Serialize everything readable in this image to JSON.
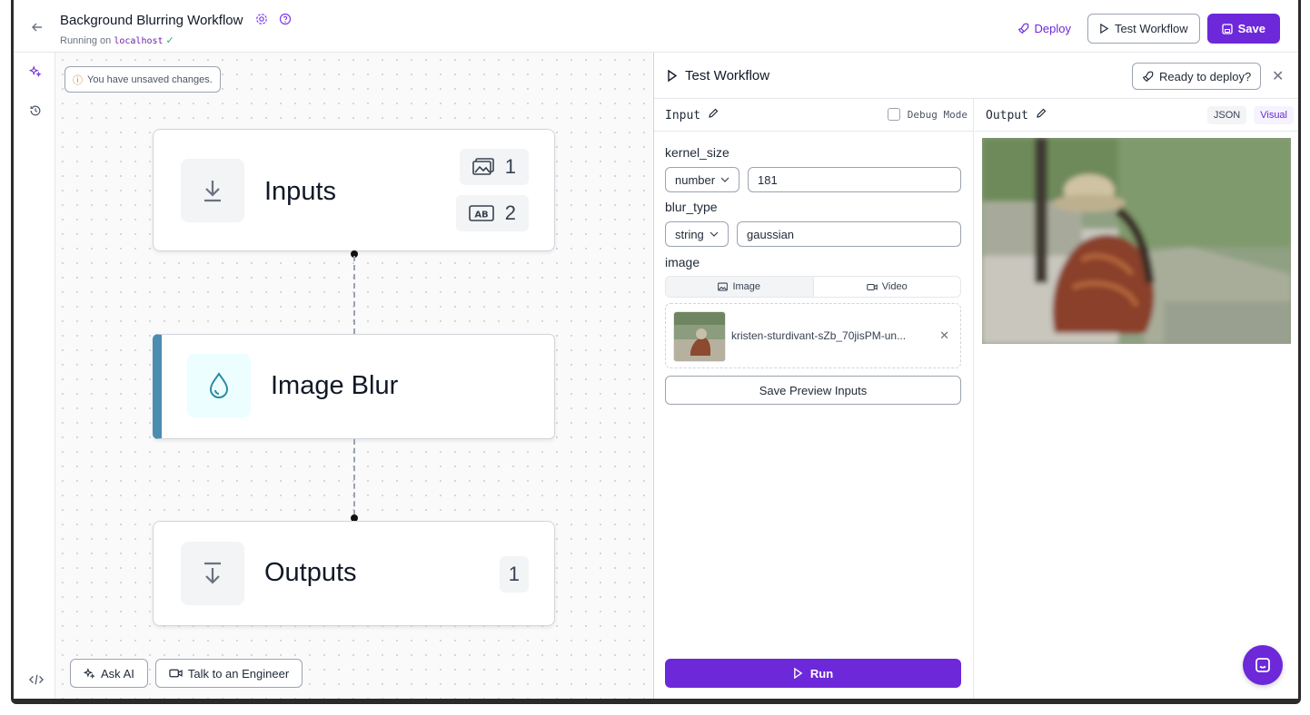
{
  "header": {
    "title": "Background Blurring Workflow",
    "subtitle_prefix": "Running on",
    "host": "localhost",
    "deploy_label": "Deploy",
    "test_label": "Test Workflow",
    "save_label": "Save"
  },
  "canvas": {
    "unsaved_notice": "You have unsaved changes.",
    "nodes": {
      "inputs": {
        "label": "Inputs",
        "image_count": "1",
        "text_count": "2"
      },
      "blur": {
        "label": "Image Blur"
      },
      "outputs": {
        "label": "Outputs",
        "count": "1"
      }
    },
    "ask_ai_label": "Ask AI",
    "engineer_label": "Talk to an Engineer"
  },
  "panel": {
    "title": "Test Workflow",
    "ready_label": "Ready to deploy?",
    "input": {
      "header": "Input",
      "debug_label": "Debug Mode",
      "fields": [
        {
          "name": "kernel_size",
          "type": "number",
          "value": "181"
        },
        {
          "name": "blur_type",
          "type": "string",
          "value": "gaussian"
        },
        {
          "name": "image"
        }
      ],
      "media_tabs": [
        "Image",
        "Video"
      ],
      "file_name": "kristen-sturdivant-sZb_70jisPM-un...",
      "save_preview_label": "Save Preview Inputs",
      "run_label": "Run"
    },
    "output": {
      "header": "Output",
      "tab_json": "JSON",
      "tab_visual": "Visual"
    }
  },
  "colors": {
    "accent": "#6d28d9",
    "node_accent": "#4a8db0"
  }
}
